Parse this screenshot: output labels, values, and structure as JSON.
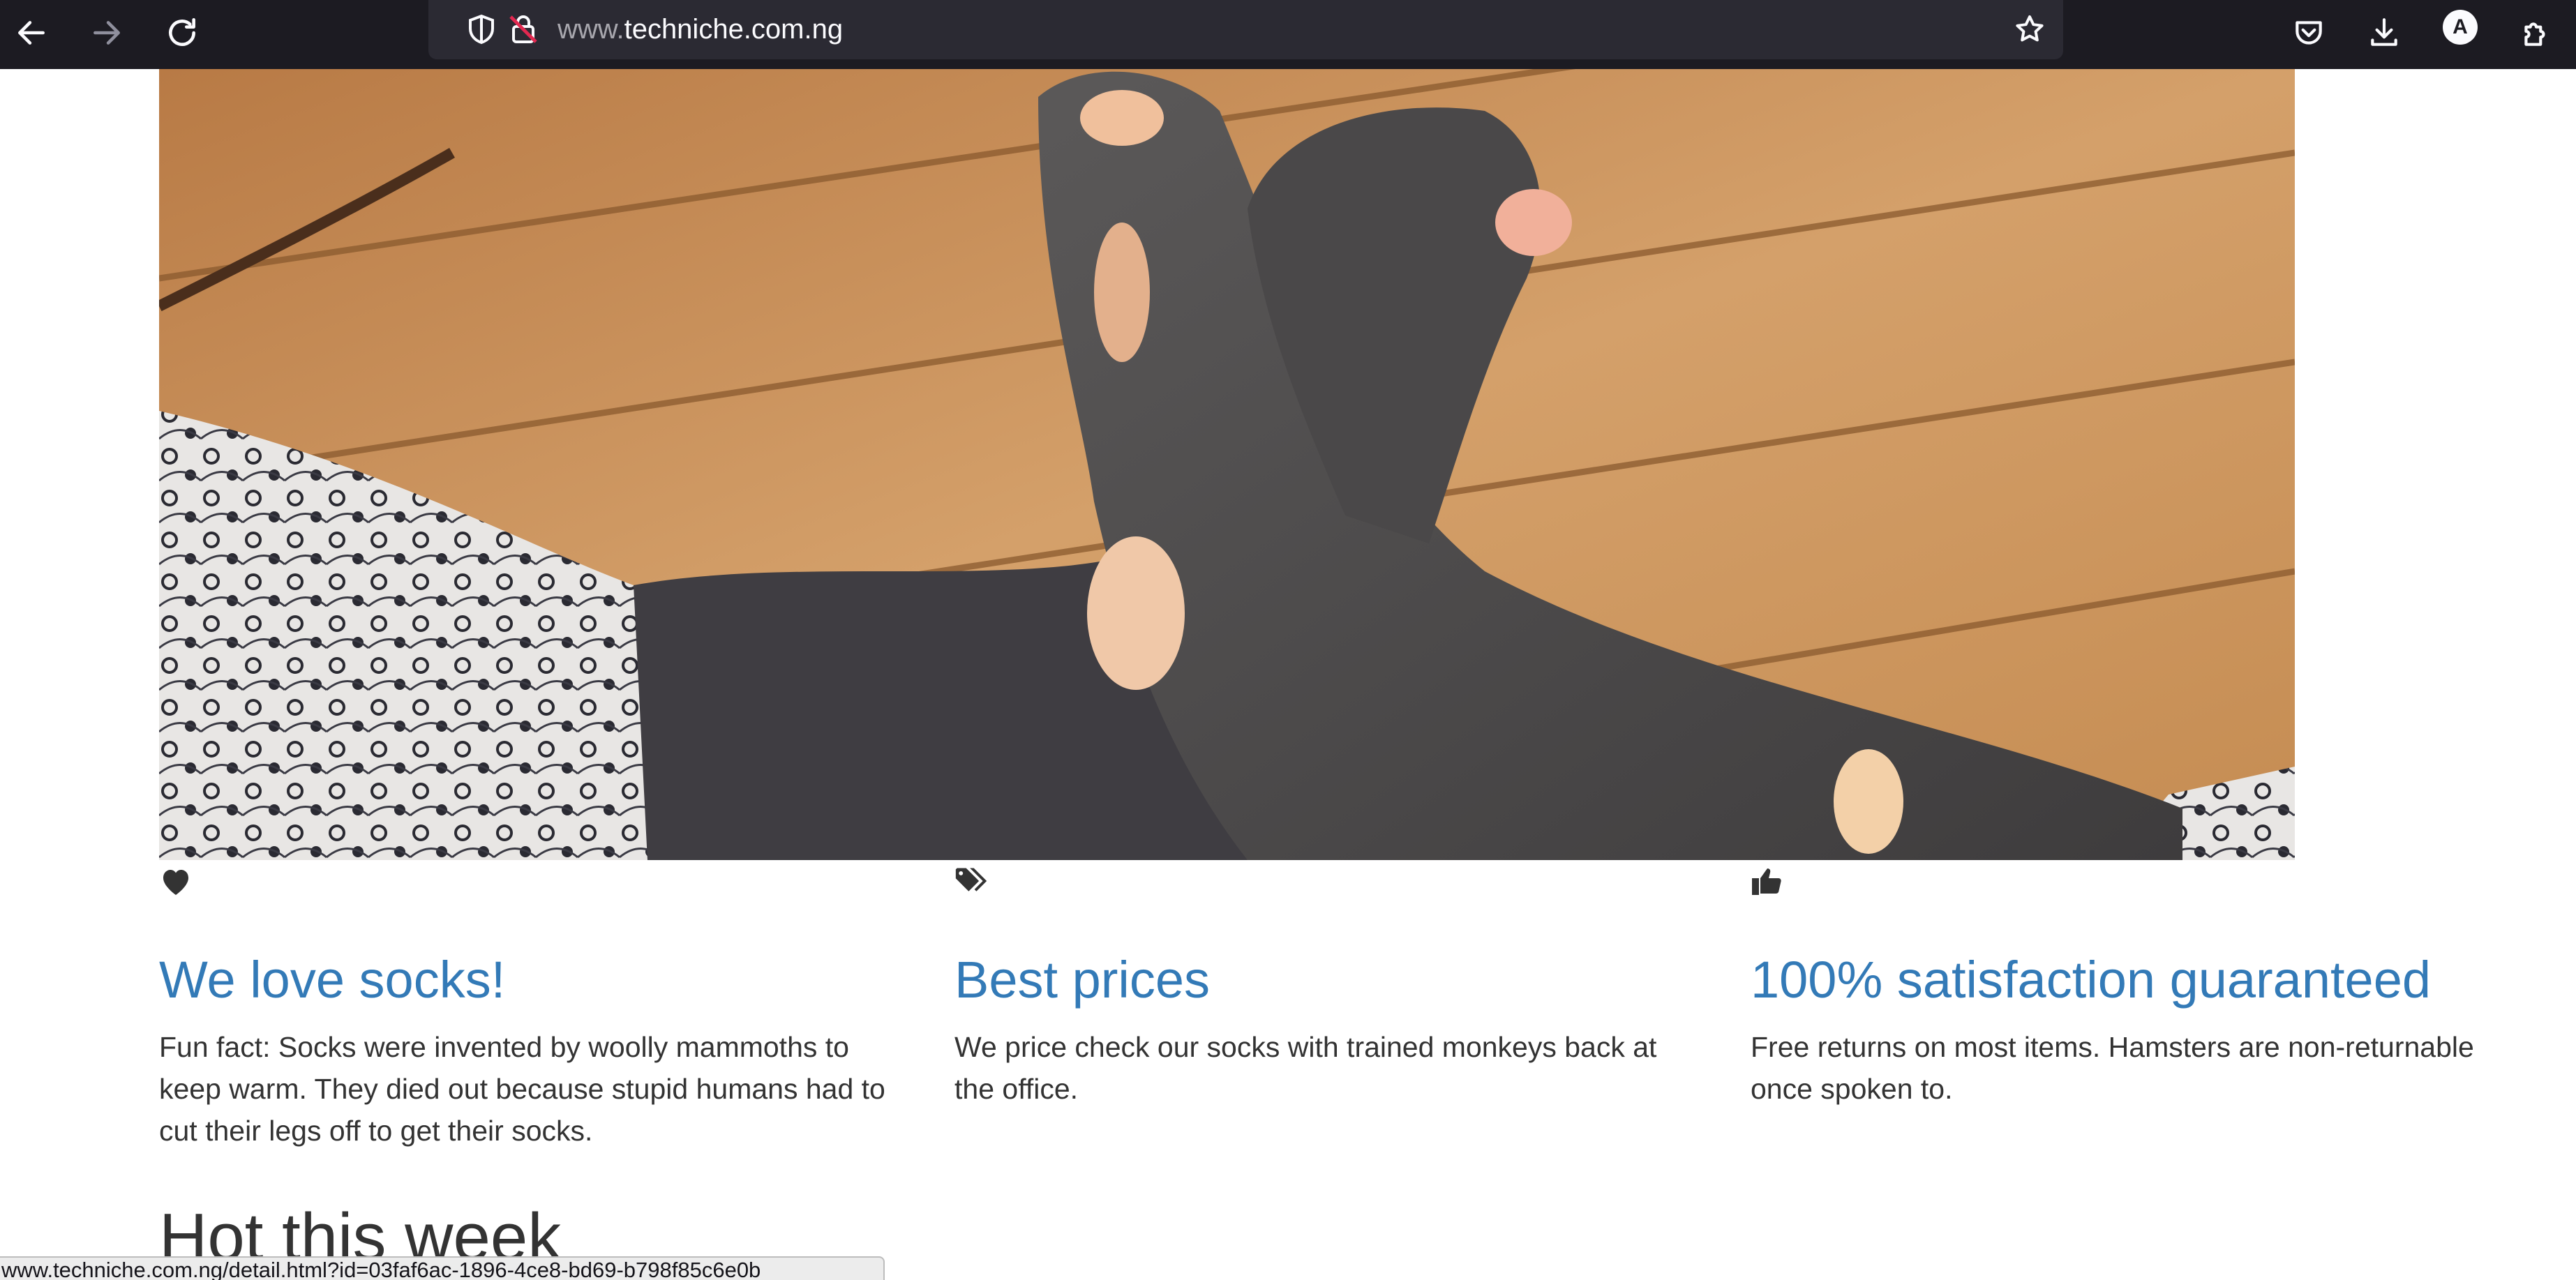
{
  "browser": {
    "url_prefix": "www.",
    "url_domain": "techniche.com.ng",
    "profile_initial": "A",
    "status_url": "www.techniche.com.ng/detail.html?id=03faf6ac-1896-4ce8-bd69-b798f85c6e0b",
    "icons": {
      "back": "arrow-left-icon",
      "forward": "arrow-right-icon",
      "reload": "reload-icon",
      "shield": "tracking-protection-shield-icon",
      "lock": "insecure-lock-icon",
      "bookmark": "star-icon",
      "pocket": "pocket-icon",
      "downloads": "download-icon",
      "extensions": "puzzle-extensions-icon"
    }
  },
  "hero": {
    "description": "photo of feet wearing worn grey socks with holes on a wooden deck"
  },
  "features": [
    {
      "icon": "heart-icon",
      "title": "We love socks!",
      "text": "Fun fact: Socks were invented by woolly mammoths to keep warm. They died out because stupid humans had to cut their legs off to get their socks."
    },
    {
      "icon": "tags-icon",
      "title": "Best prices",
      "text": "We price check our socks with trained monkeys back at the office."
    },
    {
      "icon": "thumbs-up-icon",
      "title": "100% satisfaction guaranteed",
      "text": "Free returns on most items. Hamsters are non-returnable once spoken to."
    }
  ],
  "hot": {
    "title": "Hot this week"
  },
  "colors": {
    "toolbar_bg": "#1c1b22",
    "urlbar_bg": "#2b2a33",
    "link_blue": "#337ab7",
    "body_text": "#333333"
  }
}
